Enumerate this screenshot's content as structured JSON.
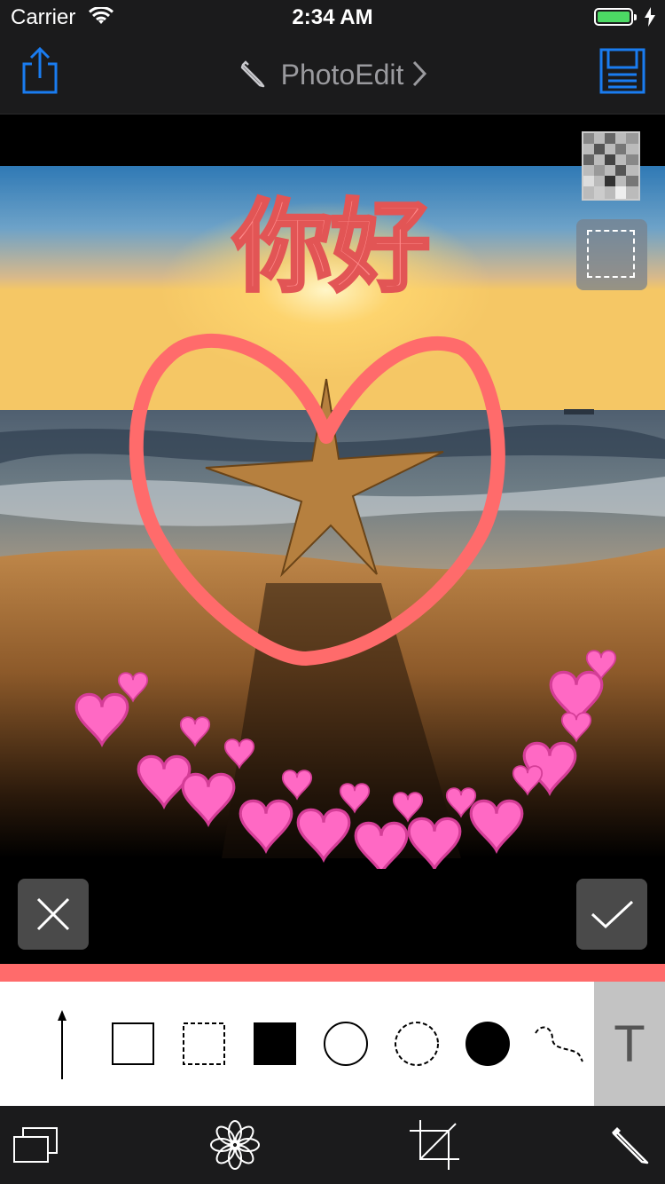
{
  "status_bar": {
    "carrier": "Carrier",
    "time": "2:34 AM",
    "battery_color": "#4cd964"
  },
  "nav_bar": {
    "title": "PhotoEdit",
    "share_icon": "share-icon",
    "save_icon": "save-icon",
    "accent_color": "#1a7cf0"
  },
  "canvas": {
    "text_annotation": "你好",
    "annotation_color": "#ff6b6b",
    "sticker_icon": "pink-heart-sticker"
  },
  "tools": {
    "selected_color": "#ff6b6b",
    "items": [
      "arrow-tool",
      "rectangle-tool",
      "dashed-rectangle-tool",
      "filled-rectangle-tool",
      "circle-tool",
      "dashed-circle-tool",
      "filled-circle-tool",
      "freehand-tool",
      "text-tool"
    ],
    "text_tool_label": "T"
  },
  "tab_bar": {
    "items": [
      "layers-icon",
      "filter-flower-icon",
      "crop-icon",
      "pencil-edit-icon"
    ]
  }
}
